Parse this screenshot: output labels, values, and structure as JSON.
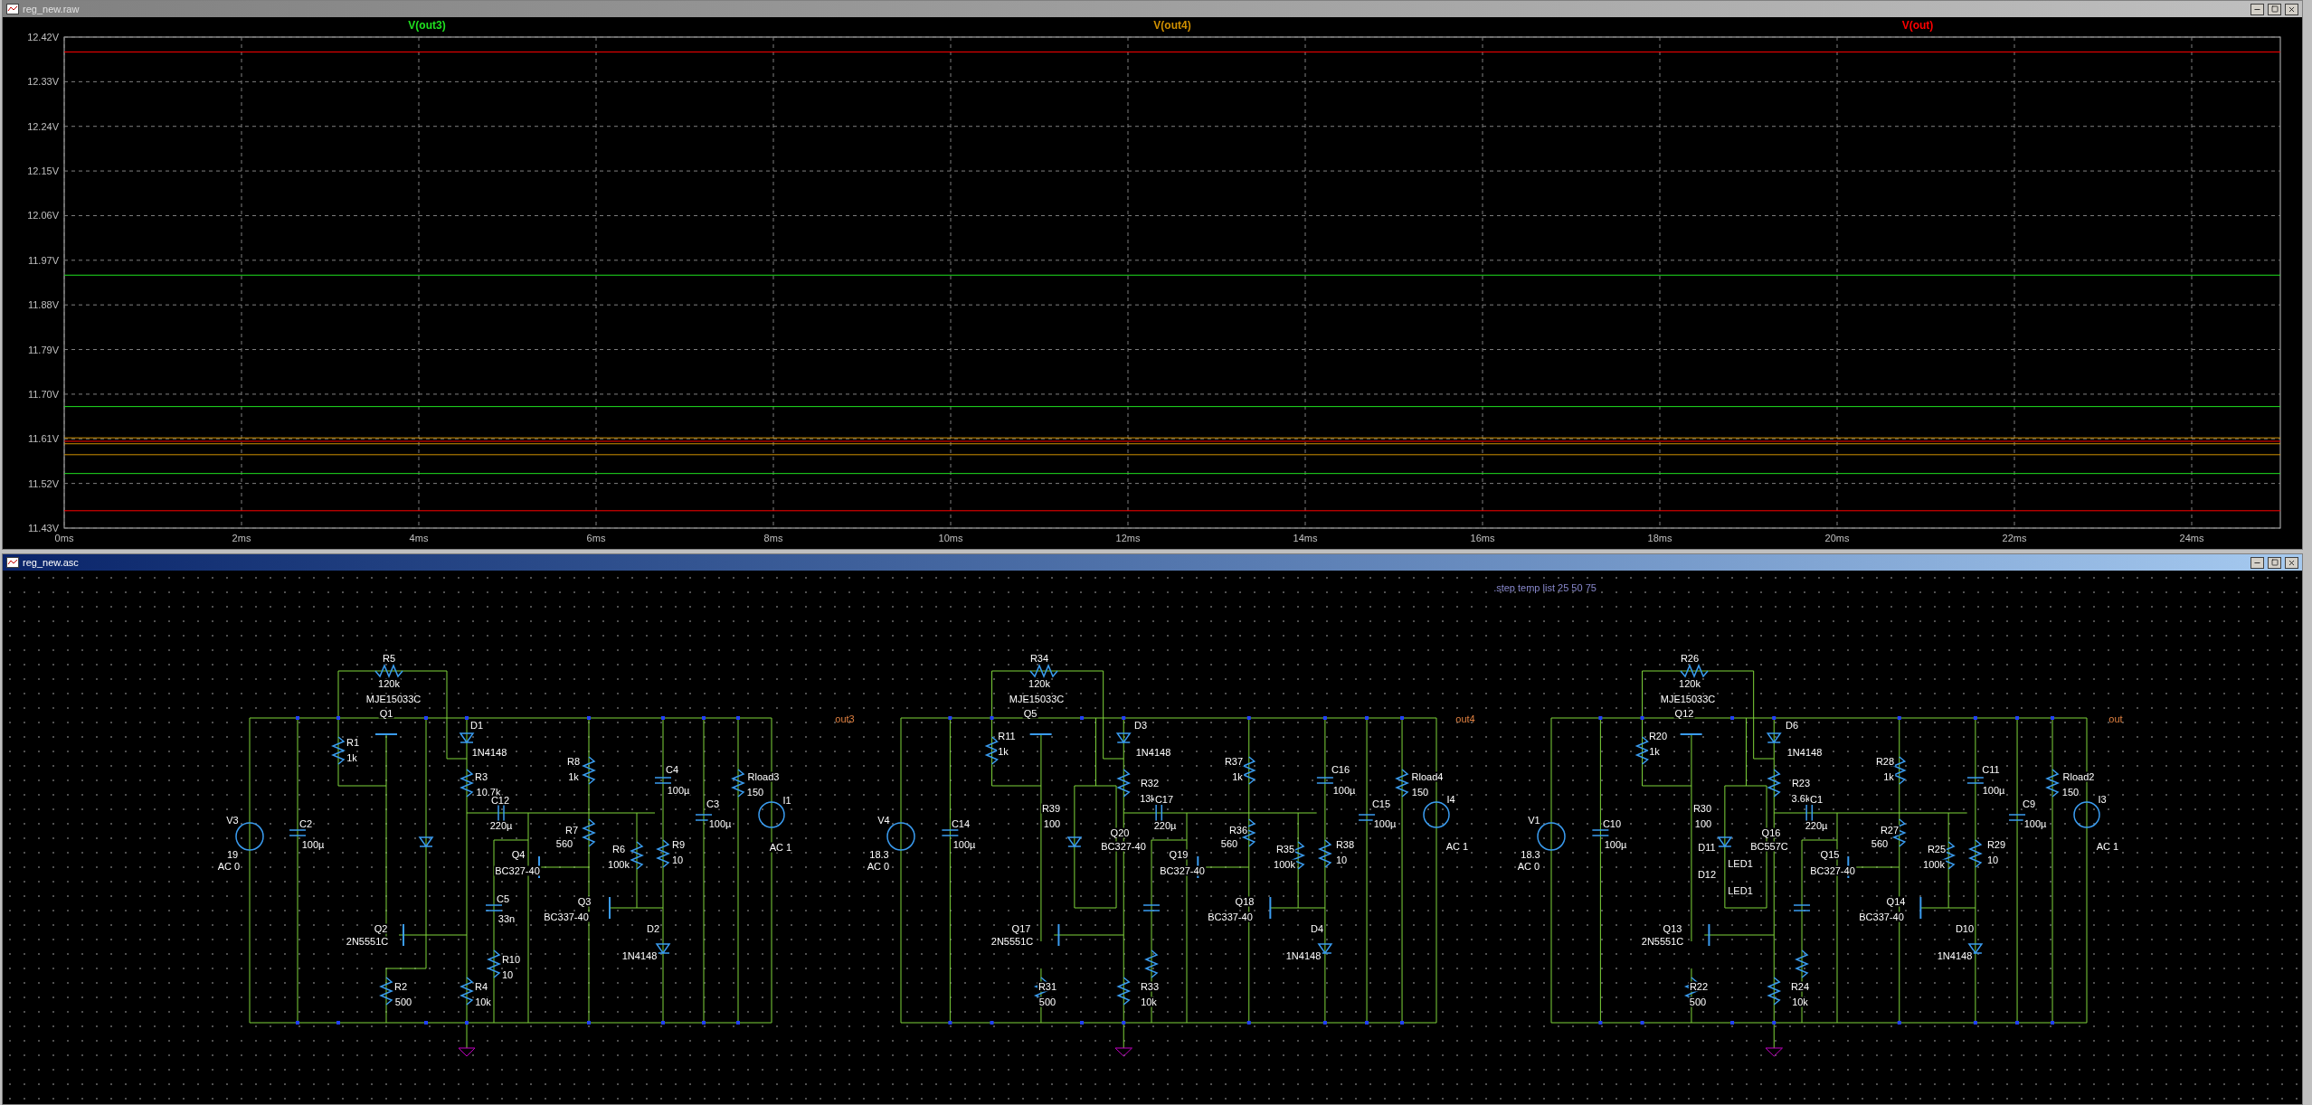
{
  "plot_window": {
    "title": "reg_new.raw",
    "chart_data": {
      "type": "line",
      "grid": true,
      "x": [
        0,
        25
      ],
      "xlim": [
        0,
        25
      ],
      "ylim": [
        11.43,
        12.42
      ],
      "xticks": [
        {
          "value": 0,
          "label": "0ms"
        },
        {
          "value": 2,
          "label": "2ms"
        },
        {
          "value": 4,
          "label": "4ms"
        },
        {
          "value": 6,
          "label": "6ms"
        },
        {
          "value": 8,
          "label": "8ms"
        },
        {
          "value": 10,
          "label": "10ms"
        },
        {
          "value": 12,
          "label": "12ms"
        },
        {
          "value": 14,
          "label": "14ms"
        },
        {
          "value": 16,
          "label": "16ms"
        },
        {
          "value": 18,
          "label": "18ms"
        },
        {
          "value": 20,
          "label": "20ms"
        },
        {
          "value": 22,
          "label": "22ms"
        },
        {
          "value": 24,
          "label": "24ms"
        }
      ],
      "yticks": [
        {
          "value": 11.43,
          "label": "11.43V"
        },
        {
          "value": 11.52,
          "label": "11.52V"
        },
        {
          "value": 11.61,
          "label": "11.61V"
        },
        {
          "value": 11.7,
          "label": "11.70V"
        },
        {
          "value": 11.79,
          "label": "11.79V"
        },
        {
          "value": 11.88,
          "label": "11.88V"
        },
        {
          "value": 11.97,
          "label": "11.97V"
        },
        {
          "value": 12.06,
          "label": "12.06V"
        },
        {
          "value": 12.15,
          "label": "12.15V"
        },
        {
          "value": 12.24,
          "label": "12.24V"
        },
        {
          "value": 12.33,
          "label": "12.33V"
        },
        {
          "value": 12.42,
          "label": "12.42V"
        }
      ],
      "series": [
        {
          "name": "V(out3)",
          "color": "#20e020",
          "values": [
            11.94,
            11.94
          ]
        },
        {
          "color": "#20e020",
          "values": [
            11.675,
            11.675
          ]
        },
        {
          "color": "#20e020",
          "values": [
            11.54,
            11.54
          ]
        },
        {
          "name": "V(out4)",
          "color": "#d09000",
          "values": [
            11.612,
            11.612
          ]
        },
        {
          "color": "#d09000",
          "values": [
            11.6,
            11.6
          ]
        },
        {
          "color": "#d09000",
          "values": [
            11.578,
            11.578
          ]
        },
        {
          "name": "V(out)",
          "color": "#ff0000",
          "values": [
            12.39,
            12.39
          ]
        },
        {
          "color": "#ff0000",
          "values": [
            11.605,
            11.605
          ]
        },
        {
          "color": "#ff0000",
          "values": [
            11.465,
            11.465
          ]
        }
      ]
    }
  },
  "schematic_window": {
    "title": "reg_new.asc",
    "directive": ".step temp list 25 50 75",
    "circuits": [
      {
        "net_label": "out3",
        "labels": [
          "R5",
          "120k",
          "MJE15033C",
          "Q1",
          "R1",
          "1k",
          "D1",
          "1N4148",
          "R3",
          "10.7k",
          "C12",
          "220µ",
          "R8",
          "1k",
          "C4",
          "100µ",
          "Rload3",
          "150",
          "C3",
          "100µ",
          "I1",
          "AC 1",
          "V3",
          "19",
          "AC 0",
          "C2",
          "100µ",
          "R7",
          "560",
          "Q4",
          "BC327-40",
          "R6",
          "100k",
          "R9",
          "10",
          "C5",
          "33n",
          "Q3",
          "BC337-40",
          "Q2",
          "2N5551C",
          "D2",
          "1N4148",
          "R10",
          "10",
          "R2",
          "500",
          "R4",
          "10k"
        ]
      },
      {
        "net_label": "out4",
        "labels": [
          "R34",
          "120k",
          "MJE15033C",
          "Q5",
          "R11",
          "1k",
          "D3",
          "1N4148",
          "R32",
          "13k",
          "C17",
          "220µ",
          "R37",
          "1k",
          "C16",
          "100µ",
          "Rload4",
          "150",
          "C15",
          "100µ",
          "I4",
          "AC 1",
          "V4",
          "18.3",
          "AC 0",
          "C14",
          "100µ",
          "R39",
          "100",
          "Q20",
          "BC327-40",
          "R36",
          "560",
          "Q19",
          "BC327-40",
          "R35",
          "100k",
          "R38",
          "10",
          "Q18",
          "BC337-40",
          "Q17",
          "2N5551C",
          "D4",
          "1N4148",
          "R31",
          "500",
          "R33",
          "10k"
        ]
      },
      {
        "net_label": "out",
        "labels": [
          "R26",
          "120k",
          "MJE15033C",
          "Q12",
          "R20",
          "1k",
          "D6",
          "1N4148",
          "R23",
          "3.6k",
          "C1",
          "220µ",
          "R28",
          "1k",
          "C11",
          "100µ",
          "Rload2",
          "150",
          "C9",
          "100µ",
          "I3",
          "AC 1",
          "V1",
          "18.3",
          "AC 0",
          "C10",
          "100µ",
          "R30",
          "100",
          "Q16",
          "D11",
          "BC557C",
          "LED1",
          "D12",
          "LED1",
          "R27",
          "560",
          "Q15",
          "BC327-40",
          "R25",
          "100k",
          "R29",
          "10",
          "Q14",
          "BC337-40",
          "Q13",
          "2N5551C",
          "D10",
          "1N4148",
          "R22",
          "500",
          "R24",
          "10k"
        ]
      }
    ]
  }
}
